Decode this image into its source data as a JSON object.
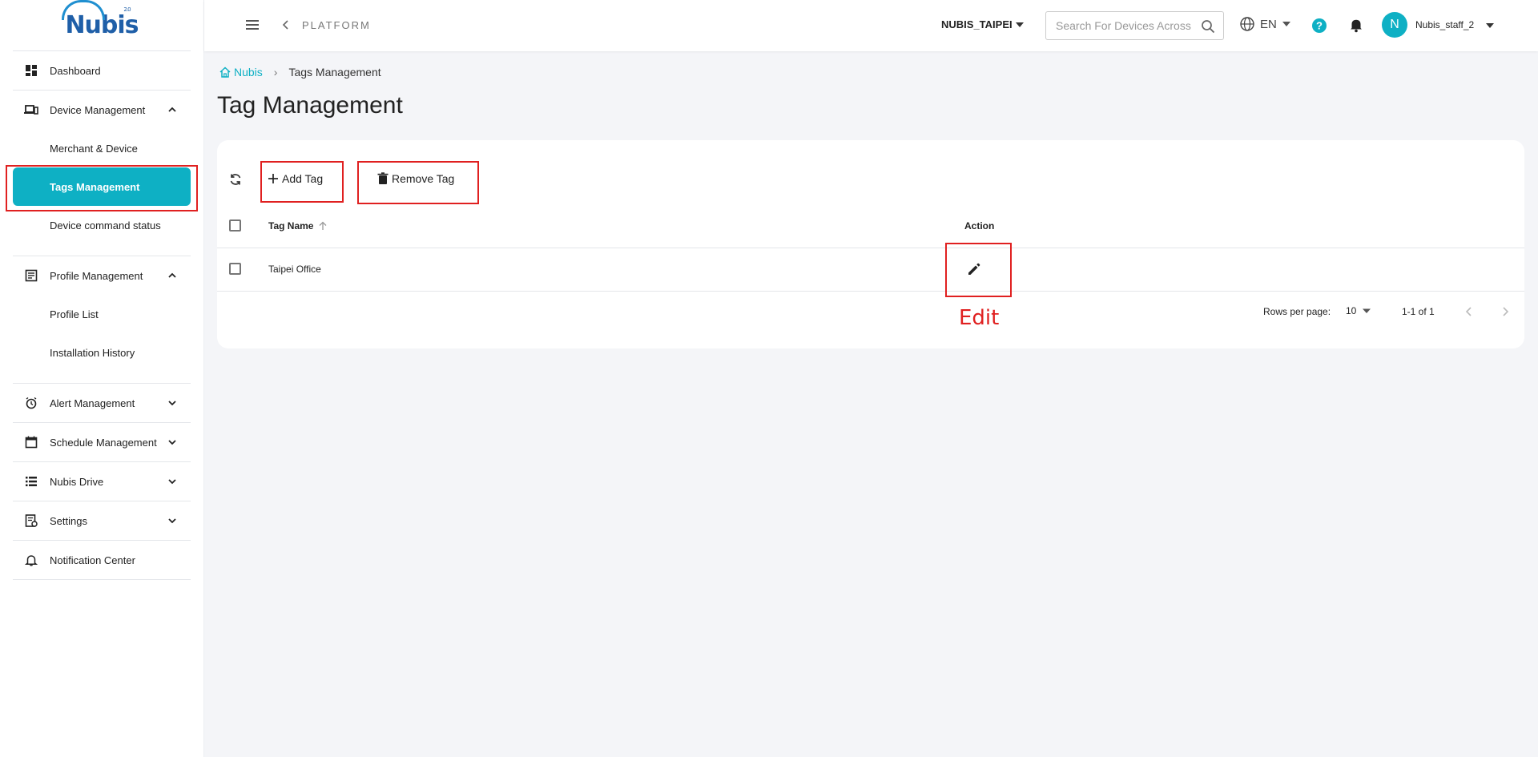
{
  "brand": {
    "logo_text": "Nubis",
    "logo_sub": "2.0"
  },
  "sidebar": {
    "dashboard": "Dashboard",
    "device_management": "Device Management",
    "merchant_device": "Merchant & Device",
    "tags_management": "Tags Management",
    "device_command_status": "Device command status",
    "profile_management": "Profile Management",
    "profile_list": "Profile List",
    "installation_history": "Installation History",
    "alert_management": "Alert Management",
    "schedule_management": "Schedule Management",
    "nubis_drive": "Nubis Drive",
    "settings": "Settings",
    "notification_center": "Notification Center"
  },
  "topbar": {
    "platform": "PLATFORM",
    "org": "NUBIS_TAIPEI",
    "search_placeholder": "Search For Devices Across",
    "lang": "EN",
    "avatar_initial": "N",
    "username": "Nubis_staff_2"
  },
  "breadcrumb": {
    "home": "Nubis",
    "current": "Tags Management"
  },
  "page_title": "Tag Management",
  "toolbar": {
    "add_tag": "Add Tag",
    "remove_tag": "Remove Tag"
  },
  "table": {
    "headers": {
      "tag_name": "Tag Name",
      "action": "Action"
    },
    "rows": [
      {
        "tag_name": "Taipei Office"
      }
    ]
  },
  "annotation": {
    "edit": "Edit"
  },
  "pagination": {
    "rows_per_page_label": "Rows per page:",
    "rows_per_page": "10",
    "range": "1-1 of 1"
  },
  "colors": {
    "accent": "#0eb0c4",
    "annotation_red": "#e02020",
    "logo_blue": "#1f5fa8"
  },
  "icons": [
    "dashboard-icon",
    "devices-icon",
    "profile-icon",
    "alarm-icon",
    "calendar-icon",
    "list-icon",
    "settings-doc-icon",
    "bell-outline-icon",
    "menu-icon",
    "chevron-left-icon",
    "search-icon",
    "globe-icon",
    "help-icon",
    "bell-icon",
    "refresh-icon",
    "plus-icon",
    "trash-icon",
    "pencil-icon",
    "home-icon"
  ]
}
